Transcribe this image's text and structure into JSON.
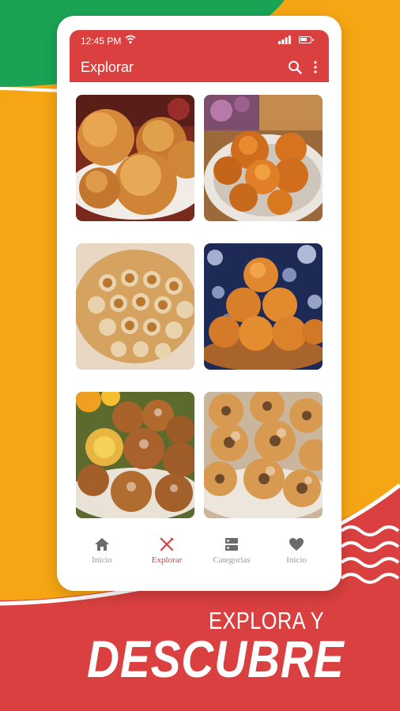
{
  "status_bar": {
    "time": "12:45 PM"
  },
  "app_bar": {
    "title": "Explorar"
  },
  "food_grid": [
    {
      "kind": "round-fritters"
    },
    {
      "kind": "glazed-fritters"
    },
    {
      "kind": "rosette-cookies"
    },
    {
      "kind": "fritter-pyramid"
    },
    {
      "kind": "sugared-fritters"
    },
    {
      "kind": "mini-donuts"
    }
  ],
  "bottom_nav": {
    "items": [
      {
        "label": "Inicio",
        "icon": "home-icon"
      },
      {
        "label": "Explorar",
        "icon": "utensils-icon"
      },
      {
        "label": "Categorías",
        "icon": "categories-icon"
      },
      {
        "label": "Inicio",
        "icon": "heart-icon"
      }
    ],
    "active_index": 1
  },
  "promo": {
    "line1": "EXPLORA Y",
    "line2": "DESCUBRE"
  },
  "colors": {
    "primary_red": "#d9403f",
    "background_orange": "#f6a614",
    "green_accent": "#1aa355",
    "inactive_gray": "#9a9a9a"
  }
}
